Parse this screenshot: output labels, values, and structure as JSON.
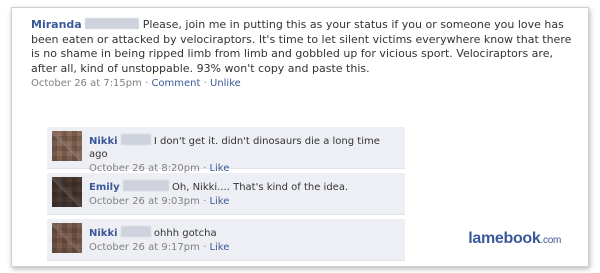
{
  "post": {
    "author": "Miranda",
    "text": "Please, join me in putting this as your status if you or someone you love has been eaten or attacked by velociraptors. It's time to let silent victims everywhere know that there is no shame in being ripped limb from limb and gobbled up for vicious sport. Velociraptors are, after all, kind of unstoppable. 93% won't copy and paste this.",
    "time": "October 26 at 7:15pm",
    "separator": "·",
    "comment_link": "Comment",
    "unlike_link": "Unlike"
  },
  "comments": [
    {
      "author": "Nikki",
      "text": "I don't get it. didn't  dinosaurs die a long time ago",
      "time": "October 26 at 8:20pm",
      "like": "Like"
    },
    {
      "author": "Emily",
      "text": "Oh, Nikki.... That's kind of the idea.",
      "time": "October 26 at 9:03pm",
      "like": "Like"
    },
    {
      "author": "Nikki",
      "text": "ohhh gotcha",
      "time": "October 26 at 9:17pm",
      "like": "Like"
    }
  ],
  "watermark": {
    "name": "lamebook",
    "suffix": ".com"
  },
  "colors": {
    "link": "#3b5998",
    "comment_bg": "#edeff4",
    "meta": "#808080"
  }
}
